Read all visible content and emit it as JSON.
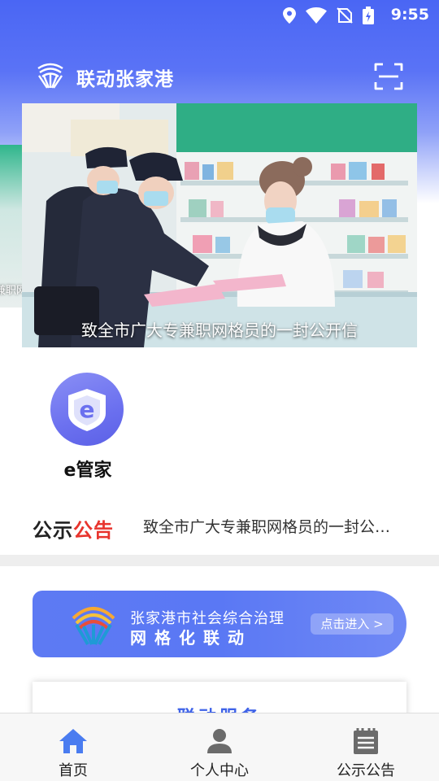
{
  "status_bar": {
    "time": "9:55"
  },
  "header": {
    "title": "联动张家港"
  },
  "banner": {
    "caption": "致全市广大专兼职网格员的一封公开信",
    "peek_caption": "兼职网"
  },
  "quick_apps": [
    {
      "label": "e管家",
      "icon_letter": "e"
    }
  ],
  "notice": {
    "logo_part1": "公示",
    "logo_part2": "公告",
    "text": "致全市广大专兼职网格员的一封公开信"
  },
  "promo": {
    "line1": "张家港市社会综合治理",
    "line2": "网格化联动",
    "button": "点击进入 >"
  },
  "card": {
    "title": "· 联动服务 ·"
  },
  "tabs": [
    {
      "label": "首页",
      "icon": "home-icon",
      "active": true
    },
    {
      "label": "个人中心",
      "icon": "person-icon",
      "active": false
    },
    {
      "label": "公示公告",
      "icon": "clipboard-icon",
      "active": false
    }
  ],
  "colors": {
    "primary": "#4a66f4",
    "active_tab": "#4a7cf0",
    "inactive_tab": "#6b6b6b",
    "notice_red": "#e8342d"
  }
}
